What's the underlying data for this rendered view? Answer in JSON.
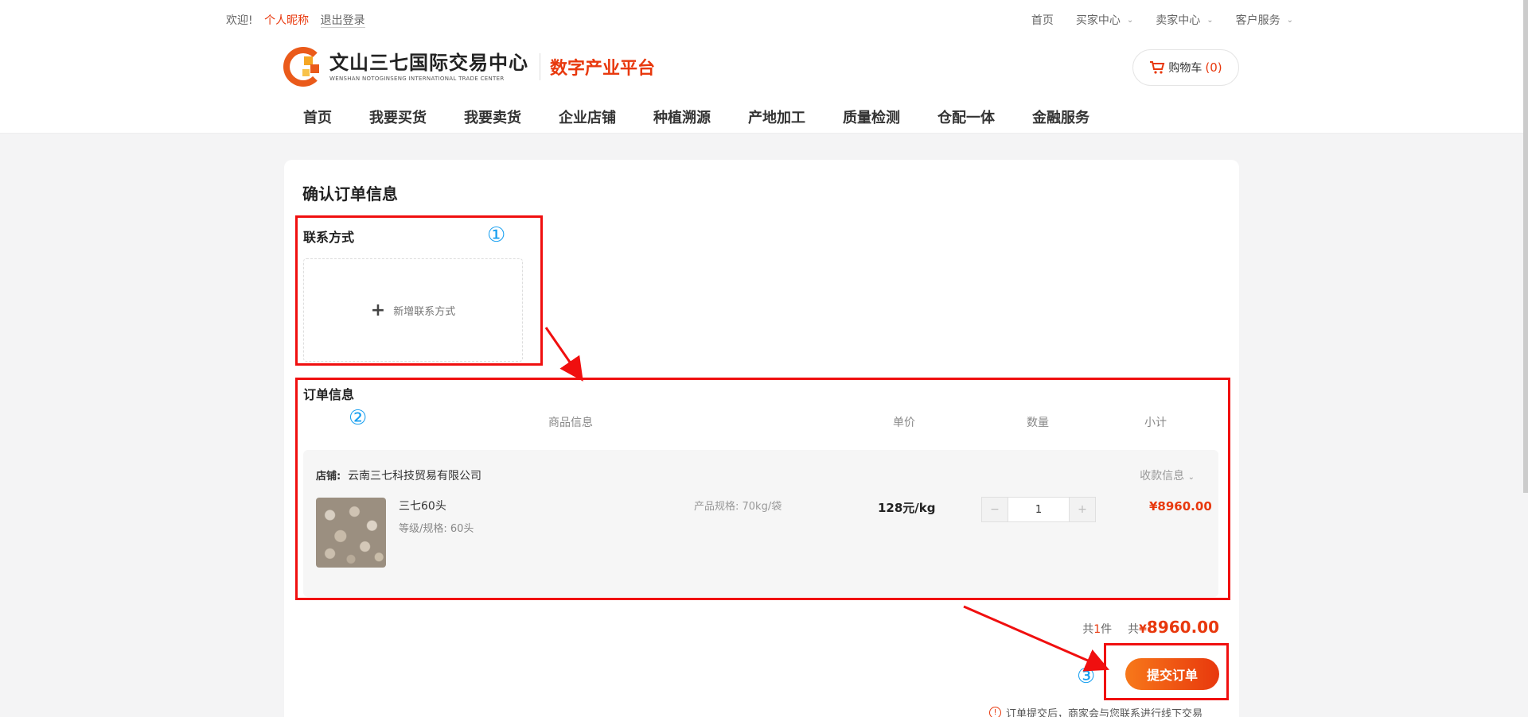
{
  "topbar": {
    "welcome": "欢迎!",
    "nickname": "个人昵称",
    "logout": "退出登录",
    "links": [
      {
        "label": "首页",
        "has_menu": false
      },
      {
        "label": "买家中心",
        "has_menu": true
      },
      {
        "label": "卖家中心",
        "has_menu": true
      },
      {
        "label": "客户服务",
        "has_menu": true
      }
    ]
  },
  "header": {
    "logo_cn": "文山三七国际交易中心",
    "logo_en": "WENSHAN NOTOGINSENG INTERNATIONAL TRADE CENTER",
    "slogan": "数字产业平台",
    "cart_label": "购物车",
    "cart_count": "(0)"
  },
  "nav": {
    "items": [
      "首页",
      "我要买货",
      "我要卖货",
      "企业店铺",
      "种植溯源",
      "产地加工",
      "质量检测",
      "仓配一体",
      "金融服务"
    ]
  },
  "page": {
    "title": "确认订单信息",
    "contact_title": "联系方式",
    "add_contact": "新增联系方式",
    "order_title": "订单信息",
    "columns": {
      "product": "商品信息",
      "price": "单价",
      "quantity": "数量",
      "subtotal": "小计"
    }
  },
  "order": {
    "shop_label": "店铺:",
    "shop_name": "云南三七科技贸易有限公司",
    "collect_info": "收款信息",
    "product_name": "三七60头",
    "grade": "等级/规格:  60头",
    "spec": "产品规格:  70kg/袋",
    "unit_price": "128元/kg",
    "qty_minus": "−",
    "quantity": "1",
    "qty_plus": "+",
    "subtotal": "¥8960.00"
  },
  "summary": {
    "count_prefix": "共",
    "count": "1",
    "count_suffix": "件",
    "total_prefix": "共",
    "total_yen": "¥",
    "total": "8960.00",
    "submit": "提交订单",
    "notice": "订单提交后，商家会与您联系进行线下交易"
  },
  "annotations": {
    "n1": "①",
    "n2": "②",
    "n3": "③",
    "color_box": "#f00f0f",
    "color_num": "#1aa0f0"
  },
  "colors": {
    "accent": "#e8380d",
    "button_gradient_start": "#f7781a"
  }
}
